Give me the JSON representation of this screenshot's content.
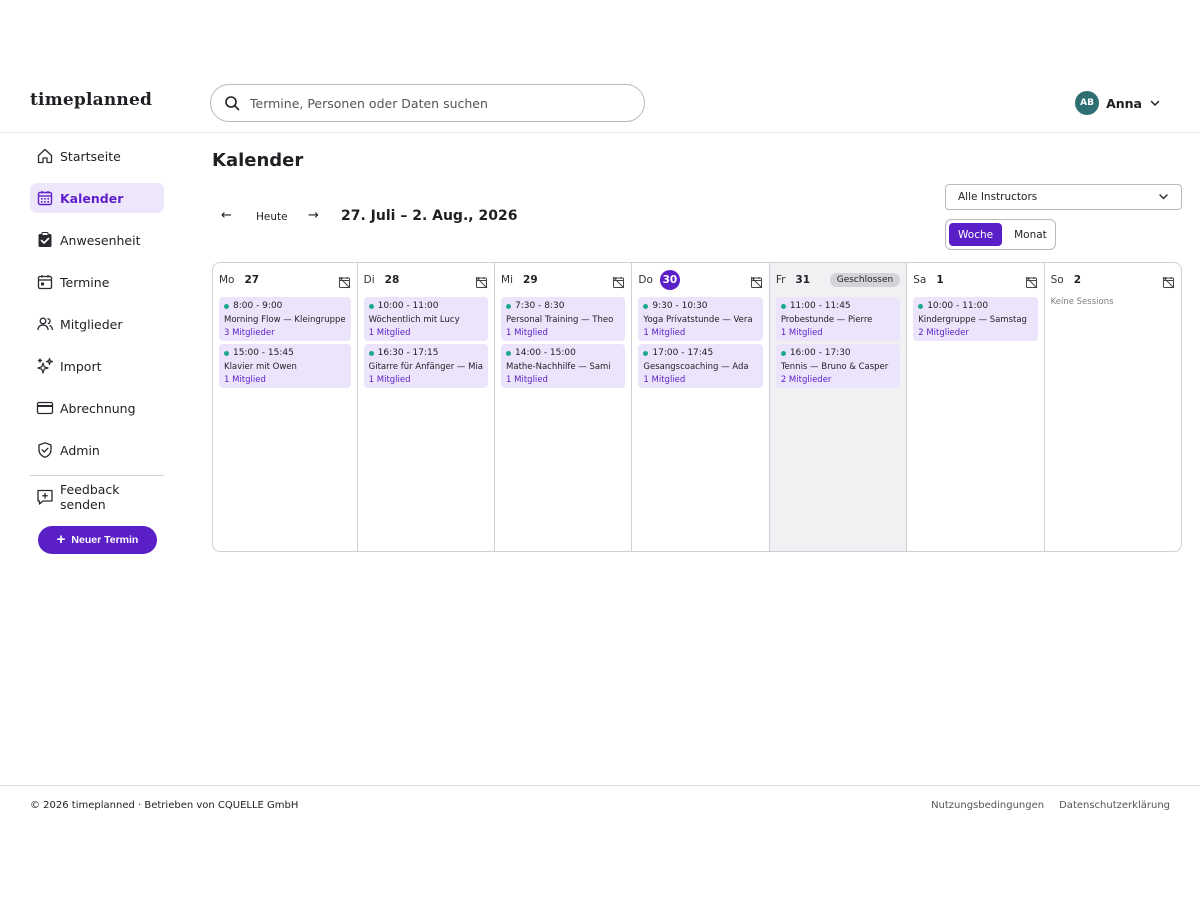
{
  "app": {
    "logo": "timeplanned"
  },
  "search": {
    "placeholder": "Termine, Personen oder Daten suchen"
  },
  "user": {
    "initials": "AB",
    "name": "Anna"
  },
  "sidebar": {
    "items": [
      {
        "label": "Startseite",
        "icon": "home-icon"
      },
      {
        "label": "Kalender",
        "icon": "calendar-icon",
        "active": true
      },
      {
        "label": "Anwesenheit",
        "icon": "clipboard-check-icon"
      },
      {
        "label": "Termine",
        "icon": "calendar-event-icon"
      },
      {
        "label": "Mitglieder",
        "icon": "users-icon"
      },
      {
        "label": "Import",
        "icon": "sparkles-icon"
      },
      {
        "label": "Abrechnung",
        "icon": "credit-card-icon"
      },
      {
        "label": "Admin",
        "icon": "shield-check-icon"
      },
      {
        "label": "Feedback senden",
        "icon": "feedback-icon"
      }
    ],
    "new_button": "Neuer Termin"
  },
  "main": {
    "title": "Kalender",
    "prev_arrow": "←",
    "today": "Heute",
    "next_arrow": "→",
    "range": "27. Juli – 2. Aug., 2026",
    "instructor_select": "Alle Instructors",
    "view_toggle": {
      "week": "Woche",
      "month": "Monat",
      "selected": "Woche"
    }
  },
  "calendar": {
    "empty_text": "Keine Sessions",
    "closed_label": "Geschlossen",
    "days": [
      {
        "dow": "Mo",
        "num": "27",
        "events": [
          {
            "time": "8:00 - 9:00",
            "title": "Morning Flow — Kleingruppe",
            "members": "3 Mitglieder"
          },
          {
            "time": "15:00 - 15:45",
            "title": "Klavier mit Owen",
            "members": "1 Mitglied"
          }
        ]
      },
      {
        "dow": "Di",
        "num": "28",
        "events": [
          {
            "time": "10:00 - 11:00",
            "title": "Wöchentlich mit Lucy",
            "members": "1 Mitglied"
          },
          {
            "time": "16:30 - 17:15",
            "title": "Gitarre für Anfänger — Mia",
            "members": "1 Mitglied"
          }
        ]
      },
      {
        "dow": "Mi",
        "num": "29",
        "events": [
          {
            "time": "7:30 - 8:30",
            "title": "Personal Training — Theo",
            "members": "1 Mitglied"
          },
          {
            "time": "14:00 - 15:00",
            "title": "Mathe-Nachhilfe — Sami",
            "members": "1 Mitglied"
          }
        ]
      },
      {
        "dow": "Do",
        "num": "30",
        "today": true,
        "events": [
          {
            "time": "9:30 - 10:30",
            "title": "Yoga Privatstunde — Vera",
            "members": "1 Mitglied"
          },
          {
            "time": "17:00 - 17:45",
            "title": "Gesangscoaching — Ada",
            "members": "1 Mitglied"
          }
        ]
      },
      {
        "dow": "Fr",
        "num": "31",
        "closed": true,
        "events": [
          {
            "time": "11:00 - 11:45",
            "title": "Probestunde — Pierre",
            "members": "1 Mitglied"
          },
          {
            "time": "16:00 - 17:30",
            "title": "Tennis — Bruno & Casper",
            "members": "2 Mitglieder"
          }
        ]
      },
      {
        "dow": "Sa",
        "num": "1",
        "events": [
          {
            "time": "10:00 - 11:00",
            "title": "Kindergruppe — Samstag",
            "members": "2 Mitglieder"
          }
        ]
      },
      {
        "dow": "So",
        "num": "2",
        "events": []
      }
    ]
  },
  "footer": {
    "copyright": "© 2026 timeplanned · Betrieben von CQUELLE GmbH",
    "terms": "Nutzungsbedingungen",
    "privacy": "Datenschutzerklärung"
  },
  "colors": {
    "accent": "#5b1fc7",
    "event_bg": "#ebe4fa",
    "dot": "#1ea98f",
    "avatar": "#2e6f73"
  }
}
